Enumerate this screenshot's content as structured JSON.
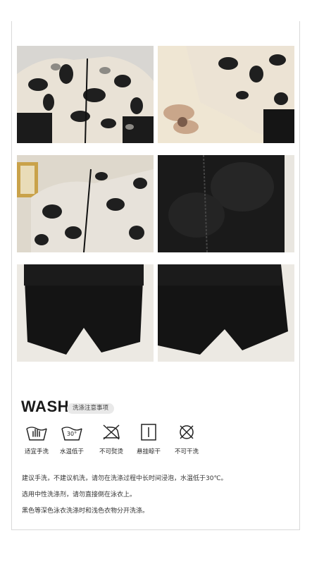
{
  "wash": {
    "title": "WASH",
    "subtitle": "洗涤注意事项"
  },
  "care_icons": [
    {
      "icon": "hand-wash-icon",
      "label": "适宜手洗",
      "temp": ""
    },
    {
      "icon": "water-temp-icon",
      "label": "水温低于",
      "temp": "30°"
    },
    {
      "icon": "no-iron-icon",
      "label": "不可熨烫",
      "temp": ""
    },
    {
      "icon": "hang-dry-icon",
      "label": "悬挂晾干",
      "temp": ""
    },
    {
      "icon": "no-dry-clean-icon",
      "label": "不可干洗",
      "temp": ""
    }
  ],
  "notes": [
    "建议手洗，不建议机洗，请勿在洗涤过程中长时间浸泡，水温低于30℃。",
    "选用中性洗涤剂，请勿直接倒在泳衣上。",
    "黑色等深色泳衣洗涤时和浅色衣物分开洗涤。"
  ]
}
